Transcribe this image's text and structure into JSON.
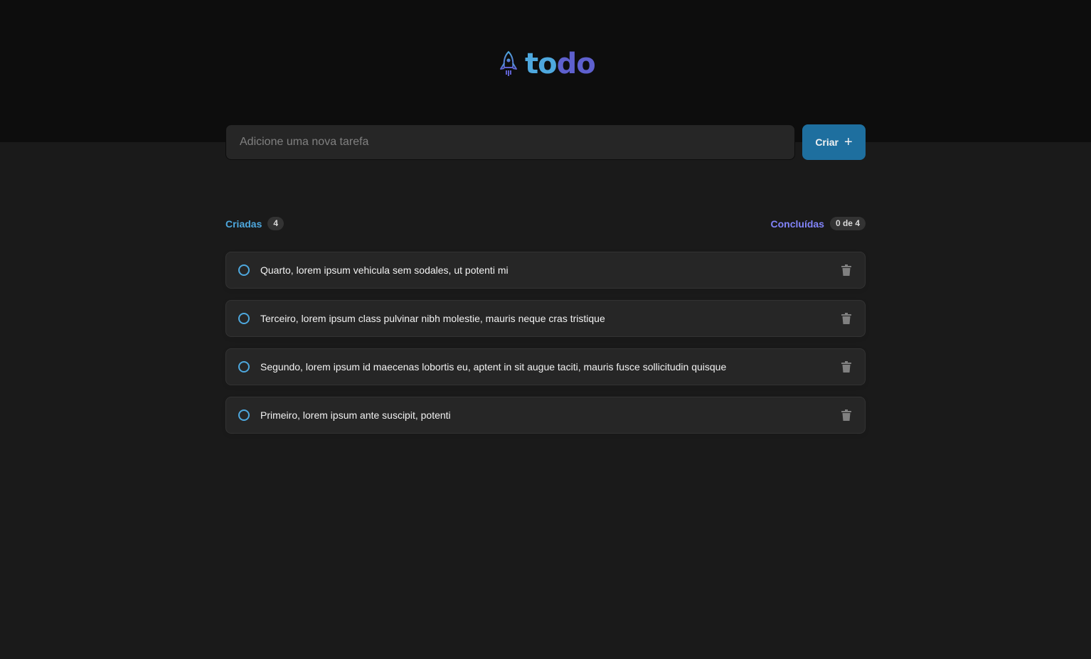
{
  "header": {
    "logo_part1": "to",
    "logo_part2": "do"
  },
  "new_task": {
    "placeholder": "Adicione uma nova tarefa",
    "value": "",
    "create_label": "Criar",
    "create_icon": "+"
  },
  "counters": {
    "created_label": "Criadas",
    "created_count": "4",
    "done_label": "Concluídas",
    "done_count": "0 de 4"
  },
  "tasks": [
    {
      "text": "Quarto, lorem ipsum vehicula sem sodales, ut potenti mi",
      "done": false
    },
    {
      "text": "Terceiro, lorem ipsum class pulvinar nibh molestie, mauris neque cras tristique",
      "done": false
    },
    {
      "text": "Segundo, lorem ipsum id maecenas lobortis eu, aptent in sit augue taciti, mauris fusce sollicitudin quisque",
      "done": false
    },
    {
      "text": "Primeiro, lorem ipsum ante suscipit, potenti",
      "done": false
    }
  ],
  "colors": {
    "blue": "#4ea8de",
    "purple": "#5e60ce",
    "purple_light": "#8284fa",
    "button": "#1e6f9f"
  },
  "icons": {
    "logo": "rocket-icon",
    "checkbox": "circle-outline-icon",
    "delete": "trash-icon"
  }
}
